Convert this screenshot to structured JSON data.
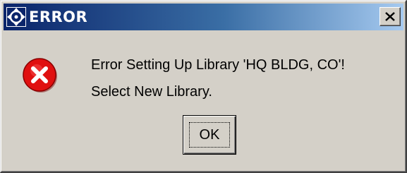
{
  "window": {
    "title": "ERROR",
    "icon": "app-crosshair-icon",
    "close_symbol": "x"
  },
  "message": {
    "icon": "error-x-icon",
    "line1": "Error Setting Up Library 'HQ BLDG, CO'!",
    "line2": "Select New Library."
  },
  "buttons": {
    "ok_label": "OK"
  },
  "colors": {
    "titlebar_start": "#0a246a",
    "titlebar_end": "#a6caf0",
    "dialog_bg": "#d4d0c8",
    "error_red": "#e01010"
  }
}
